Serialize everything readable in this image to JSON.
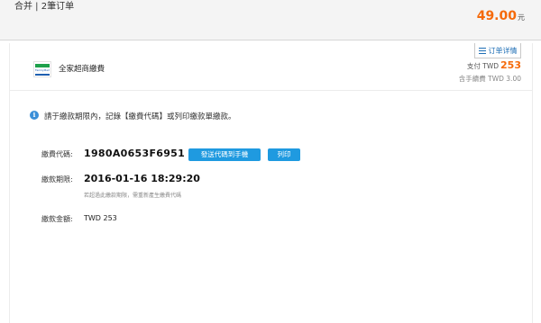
{
  "header": {
    "merge_label": "合并 | 2筆订单",
    "total_amount": "49.00",
    "total_unit": "元"
  },
  "card": {
    "detail_tab_label": "订单详情",
    "method_name": "全家超商繳費",
    "logo_text": "FamilyMart",
    "pay_label": "支付 TWD",
    "pay_amount": "253",
    "fee_label": "含手續費 TWD 3.00"
  },
  "notice": {
    "text": "請于繳款期限內，記錄【繳費代碼】或列印繳款單繳款。"
  },
  "fields": {
    "code_label": "繳費代碼:",
    "code_value": "1980A0653F6951",
    "send_button": "發送代碼到手機",
    "print_button": "列印",
    "deadline_label": "繳款期限:",
    "deadline_value": "2016-01-16 18:29:20",
    "deadline_note": "若超過此繳款期限，需重新產生繳費代碼",
    "amount_label": "繳款金額:",
    "amount_value": "TWD 253"
  },
  "colors": {
    "accent_orange": "#f56a0a",
    "button_blue": "#1f9ae0",
    "info_blue": "#3a8fd8"
  }
}
